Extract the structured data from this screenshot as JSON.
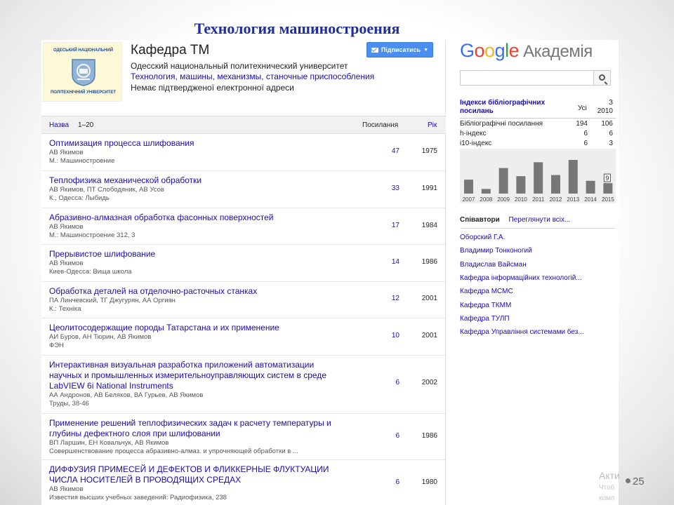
{
  "slide": {
    "title": "Технология машиностроения",
    "page_number": "25",
    "activation_line1": "Акти",
    "activation_line2": "Чтоб",
    "activation_line3": "комп"
  },
  "profile": {
    "logo_line1": "ОДЕСЬКИЙ НАЦІОНАЛЬНИЙ",
    "logo_line2": "ПОЛІТЕХНІЧНИЙ УНІВЕРСИТЕТ",
    "name": "Кафедра ТМ",
    "affiliation": "Одесский национальный политехнический университет",
    "interests": "Технология, машины, механизмы, станочные приспособления",
    "email_status": "Немає підтвердженої електронної адреси",
    "follow_label": "Підписатись"
  },
  "table": {
    "col_title": "Назва",
    "range": "1–20",
    "col_cites": "Посилання",
    "col_year": "Рік",
    "rows": [
      {
        "title": "Оптимизация процесса шлифования",
        "authors": "АВ Якимов",
        "venue": "М.: Машиностроение",
        "cites": "47",
        "year": "1975"
      },
      {
        "title": "Теплофизика механической обработки",
        "authors": "АВ Якимов, ПТ Слободяник, АВ Усов",
        "venue": "К., Одесса: Лыбидь",
        "cites": "33",
        "year": "1991"
      },
      {
        "title": "Абразивно-алмазная обработка фасонных поверхностей",
        "authors": "АВ Якимов",
        "venue": "М.: Машиностроение 312, 3",
        "cites": "17",
        "year": "1984"
      },
      {
        "title": "Прерывистое шлифование",
        "authors": "АВ Якимов",
        "venue": "Киев-Одесса: Вища школа",
        "cites": "14",
        "year": "1986"
      },
      {
        "title": "Обработка деталей на отделочно-расточных станках",
        "authors": "ПА Линчевский, ТГ Джугурян, АА Оргиян",
        "venue": "К.: Техніка",
        "cites": "12",
        "year": "2001"
      },
      {
        "title": "Цеолитосодержащие породы Татарстана и их применение",
        "authors": "АИ Буров, АН Тюрин, АВ Якимов",
        "venue": "ФЭН",
        "cites": "10",
        "year": "2001"
      },
      {
        "title": "Интерактивная визуальная разработка приложений автоматизации научных и промышленных измерительноуправляющих систем в среде LabVIEW 6i National Instruments",
        "authors": "АА Андронов, АВ Беляков, ВА Гурьев, АВ Якимов",
        "venue": "Труды, 38-46",
        "cites": "6",
        "year": "2002"
      },
      {
        "title": "Применение решений теплофизических задач к расчету температуры и глубины дефектного слоя при шлифовании",
        "authors": "ВП Ларшин, ЕН Ковальчук, АВ Якимов",
        "venue": "Совершенствование процесса абразивно-алмаз. и упрочняющей обработки в ...",
        "cites": "6",
        "year": "1986"
      },
      {
        "title": "ДИФФУЗИЯ ПРИМЕСЕЙ И ДЕФЕКТОВ И ФЛИККЕРНЫЕ ФЛУКТУАЦИИ ЧИСЛА НОСИТЕЛЕЙ В ПРОВОДЯЩИХ СРЕДАХ",
        "authors": "АВ Якимов",
        "venue": "Известия высших учебных заведений: Радиофизика, 238",
        "cites": "6",
        "year": "1980"
      }
    ]
  },
  "sidebar": {
    "logo_letters": [
      "G",
      "o",
      "o",
      "g",
      "l",
      "e"
    ],
    "logo_suffix": "Академія",
    "search_placeholder": "",
    "indices_title": "Індекси бібліографічних посилань",
    "col_all": "Усі",
    "col_since": "З 2010",
    "indices": [
      {
        "name": "Бібліографічні посилання",
        "all": "194",
        "since": "106"
      },
      {
        "name": "h-індекс",
        "all": "6",
        "since": "6"
      },
      {
        "name": "i10-індекс",
        "all": "6",
        "since": "3"
      }
    ],
    "coauthors_title": "Співавтори",
    "coauthors_view_all": "Переглянути всіх...",
    "coauthors": [
      "Оборский Г.А.",
      "Владимир Тонконогий",
      "Владислав Вайсман",
      "Кафедра інформаційних технологій...",
      "Кафедра МСМС",
      "Кафедра ТКММ",
      "Кафедра ТУЛП",
      "Кафедра Управління системами без..."
    ]
  },
  "chart_data": {
    "type": "bar",
    "categories": [
      "2007",
      "2008",
      "2009",
      "2010",
      "2011",
      "2012",
      "2013",
      "2014",
      "2015"
    ],
    "values": [
      12,
      4,
      22,
      15,
      27,
      16,
      29,
      11,
      9
    ],
    "data_labels": {
      "2015": "9"
    },
    "bar_color": "#777777",
    "grid": false
  }
}
